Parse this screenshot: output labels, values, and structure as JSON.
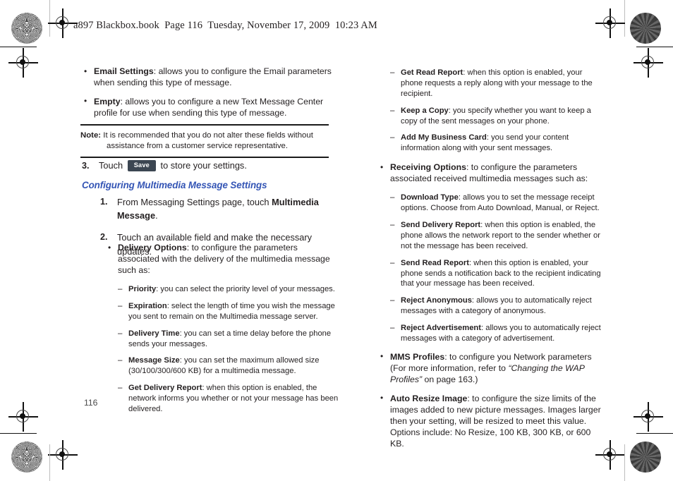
{
  "document": {
    "running_header": "a897 Blackbox.book  Page 116  Tuesday, November 17, 2009  10:23 AM",
    "folio": "116",
    "accent_color": "#3455b5",
    "softkey_color": "#3c4652"
  },
  "left_column": {
    "top_bullets": [
      {
        "marker": "•",
        "term": "Email Settings",
        "text": ": allows you to configure the Email parameters when sending this type of message."
      },
      {
        "marker": "•",
        "term": "Empty",
        "text": ": allows you to configure a new Text Message Center profile for use when sending this type of message."
      }
    ],
    "note": {
      "label": "Note:",
      "text": "It is recommended that you do not alter these fields without assistance from a customer service representative."
    },
    "step3": {
      "marker": "3.",
      "text_before": "Touch",
      "softkey_label": "Save",
      "text_after": "to store your settings."
    },
    "section_heading": "Configuring Multimedia Message Settings",
    "steps": [
      {
        "marker": "1.",
        "text_before": "From Messaging Settings page, touch ",
        "bold": "Multimedia Message",
        "text_after": "."
      },
      {
        "marker": "2.",
        "text_before": "Touch an available field and make the necessary updates.",
        "bold": "",
        "text_after": ""
      }
    ],
    "delivery_block": {
      "bullet": {
        "marker": "•",
        "term": "Delivery Options",
        "text": ": to configure the parameters associated with the delivery of the multimedia message such as:"
      },
      "sub_items": [
        {
          "marker": "–",
          "term": "Priority",
          "text": ": you can select the priority level of your messages."
        },
        {
          "marker": "–",
          "term": "Expiration",
          "text": ": select the length of time you wish the message you sent to remain on the Multimedia message server."
        },
        {
          "marker": "–",
          "term": "Delivery Time",
          "text": ": you can set a time delay before the phone sends your messages."
        },
        {
          "marker": "–",
          "term": "Message Size",
          "text": ": you can set the maximum allowed size (30/100/300/600 KB) for a multimedia message."
        },
        {
          "marker": "–",
          "term": "Get Delivery Report",
          "text": ": when this option is enabled, the network informs you whether or not your message has been delivered."
        }
      ]
    }
  },
  "right_column": {
    "delivery_sub_continued": [
      {
        "marker": "–",
        "term": "Get Read Report",
        "text": ": when this option is enabled, your phone requests a reply along with your message to the recipient."
      },
      {
        "marker": "–",
        "term": "Keep a Copy",
        "text": ": you specify whether you want to keep a copy of the sent messages on your phone."
      },
      {
        "marker": "–",
        "term": "Add My Business Card",
        "text": ": you send your content information along with your sent messages."
      }
    ],
    "receiving_options": {
      "marker": "•",
      "term": "Receiving Options",
      "text": ": to configure the parameters associated received multimedia messages such as:",
      "sub_items": [
        {
          "marker": "–",
          "term": "Download Type",
          "text": ": allows you to set the message receipt options. Choose from Auto Download, Manual, or Reject."
        },
        {
          "marker": "–",
          "term": "Send Delivery Report",
          "text": ": when this option is enabled, the phone allows the network report to the sender whether or not the message has been received."
        },
        {
          "marker": "–",
          "term": "Send Read Report",
          "text": ": when this option is enabled, your phone sends a notification back to the recipient indicating that your message has been received."
        },
        {
          "marker": "–",
          "term": "Reject Anonymous",
          "text": ": allows you to automatically reject messages with a category of anonymous."
        },
        {
          "marker": "–",
          "term": "Reject Advertisement",
          "text": ": allows you to automatically reject messages with a category of advertisement."
        }
      ]
    },
    "mms_profiles": {
      "marker": "•",
      "term": "MMS Profiles",
      "text_before": ": to configure you Network parameters (For more information, refer to ",
      "cross_reference": "“Changing the WAP Profiles”",
      "text_after": " on page 163.)"
    },
    "auto_resize": {
      "marker": "•",
      "term": "Auto Resize Image",
      "text": ": to configure the size limits of the images added to new picture messages. Images larger then your setting, will be resized to meet this value. Options include: No Resize, 100 KB, 300 KB, or 600 KB."
    }
  }
}
